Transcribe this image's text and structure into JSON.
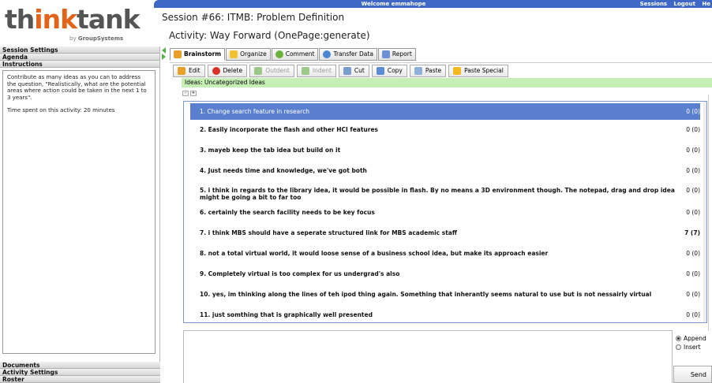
{
  "logo": {
    "main": "thinktank",
    "main_a": "th",
    "main_b": "i",
    "main_c": "nk",
    "main_d": "tank",
    "sub_prefix": "by",
    "sub_brand": "GroupSystems"
  },
  "topbar": {
    "welcome": "Welcome emmahope",
    "links": [
      "Sessions",
      "Logout",
      "He"
    ]
  },
  "session_title": "Session #66: ITMB: Problem Definition",
  "activity_title": "Activity: Way Forward (OnePage:generate)",
  "left": {
    "headers": [
      "Session Settings",
      "Agenda",
      "Instructions"
    ],
    "instructions": [
      "Contribute as many ideas as you can to address the question, \"Realistically, what are the potential areas where action could be taken in the next 1 to 3 years\".",
      "Time spent on this activity: 20 minutes"
    ],
    "bottom_headers": [
      "Documents",
      "Activity Settings",
      "Roster"
    ]
  },
  "tabs": [
    "Brainstorm",
    "Organize",
    "Comment",
    "Transfer Data",
    "Report"
  ],
  "toolbar": [
    "Edit",
    "Delete",
    "Outdent",
    "Indent",
    "Cut",
    "Copy",
    "Paste",
    "Paste Special"
  ],
  "category": "Ideas: Uncategorized Ideas",
  "mini_buttons": [
    "-",
    "+"
  ],
  "ideas": [
    {
      "text": "1. Change search feature in research",
      "count": "0 (0)"
    },
    {
      "text": "2. Easily incorporate the flash and other HCI features",
      "count": "0 (0)"
    },
    {
      "text": "3. mayeb keep the tab idea but build on it",
      "count": "0 (0)"
    },
    {
      "text": "4. Just needs time and knowledge, we've got both",
      "count": "0 (0)"
    },
    {
      "text": "5. i think in regards to the library idea, it would be possible in flash. By no means a 3D environment though. The notepad, drag and drop idea might be going a bit to far too",
      "count": "0 (0)"
    },
    {
      "text": "6. certainly the search facility needs to be key focus",
      "count": "0 (0)"
    },
    {
      "text": "7. i think MBS should have a seperate structured link for MBS academic staff",
      "count": "7 (7)"
    },
    {
      "text": "8. not a total virtual world, it would loose sense of a business school idea, but make its approach easier",
      "count": "0 (0)"
    },
    {
      "text": "9. Completely virtual is too complex for us undergrad's also",
      "count": "0 (0)"
    },
    {
      "text": "10. yes, im thinking along the lines of teh ipod thing again. Something that inherantly seems natural to use but is not nessairly virtual",
      "count": "0 (0)"
    },
    {
      "text": "11. just somthing that is graphically well presented",
      "count": "0 (0)"
    }
  ],
  "entry": {
    "options": [
      "Append",
      "Insert"
    ],
    "send": "Send"
  }
}
